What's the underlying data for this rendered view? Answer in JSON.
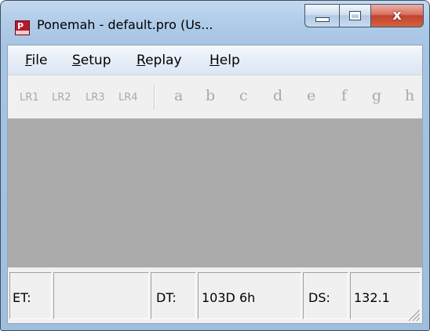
{
  "window": {
    "title": "Ponemah - default.pro (Us...",
    "app_icon_letter": "P",
    "icon": "ponemah-app-icon",
    "controls": {
      "minimize_icon": "minimize-icon",
      "maximize_icon": "maximize-icon",
      "close_symbol": "x"
    }
  },
  "menu": [
    {
      "label": "File",
      "accel": "F",
      "rest": "ile"
    },
    {
      "label": "Setup",
      "accel": "S",
      "rest": "etup"
    },
    {
      "label": "Replay",
      "accel": "R",
      "rest": "eplay"
    },
    {
      "label": "Help",
      "accel": "H",
      "rest": "elp"
    }
  ],
  "toolbar": {
    "lr_buttons": [
      "LR1",
      "LR2",
      "LR3",
      "LR4"
    ],
    "letter_buttons": [
      "a",
      "b",
      "c",
      "d",
      "e",
      "f",
      "g",
      "h"
    ],
    "state": "disabled"
  },
  "status": {
    "et_label": "ET:",
    "et_value": "",
    "dt_label": "DT:",
    "dt_value": "103D 6h",
    "ds_label": "DS:",
    "ds_value": "132.1"
  },
  "colors": {
    "titlebar": "#aecbe8",
    "close_button": "#c2432f",
    "workspace": "#ababab",
    "disabled_text": "#a9a9a9"
  }
}
